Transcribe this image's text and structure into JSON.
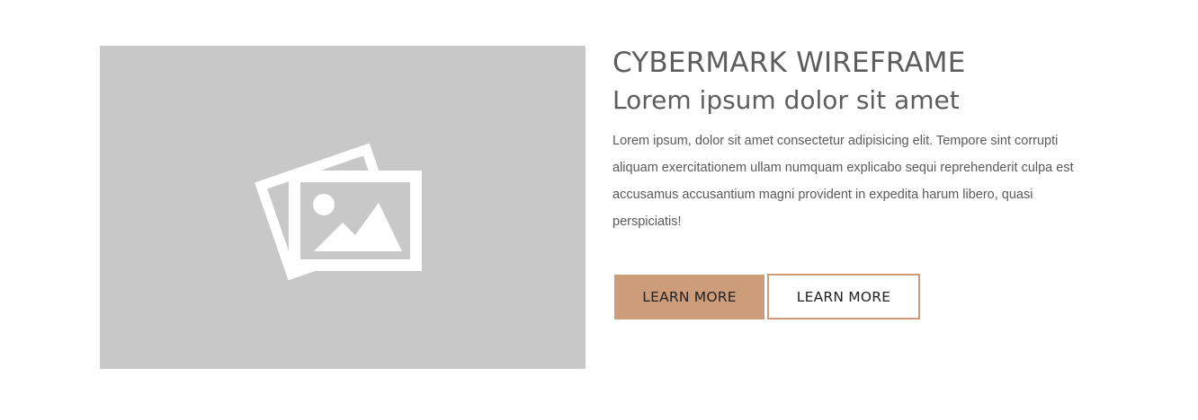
{
  "media": {
    "icon": "images-placeholder-icon",
    "background_color": "#c8c8c8",
    "icon_color": "#ffffff"
  },
  "section": {
    "kicker": "CYBERMARK WIREFRAME",
    "headline": "Lorem ipsum dolor sit amet",
    "body": "Lorem ipsum, dolor sit amet consectetur adipisicing elit. Tempore sint corrupti aliquam exercitationem ullam numquam explicabo sequi reprehenderit culpa est accusamus accusantium magni provident in expedita harum libero, quasi perspiciatis!"
  },
  "buttons": {
    "primary_label": "LEARN MORE",
    "secondary_label": "LEARN MORE",
    "accent_color": "#cc9c7b"
  }
}
